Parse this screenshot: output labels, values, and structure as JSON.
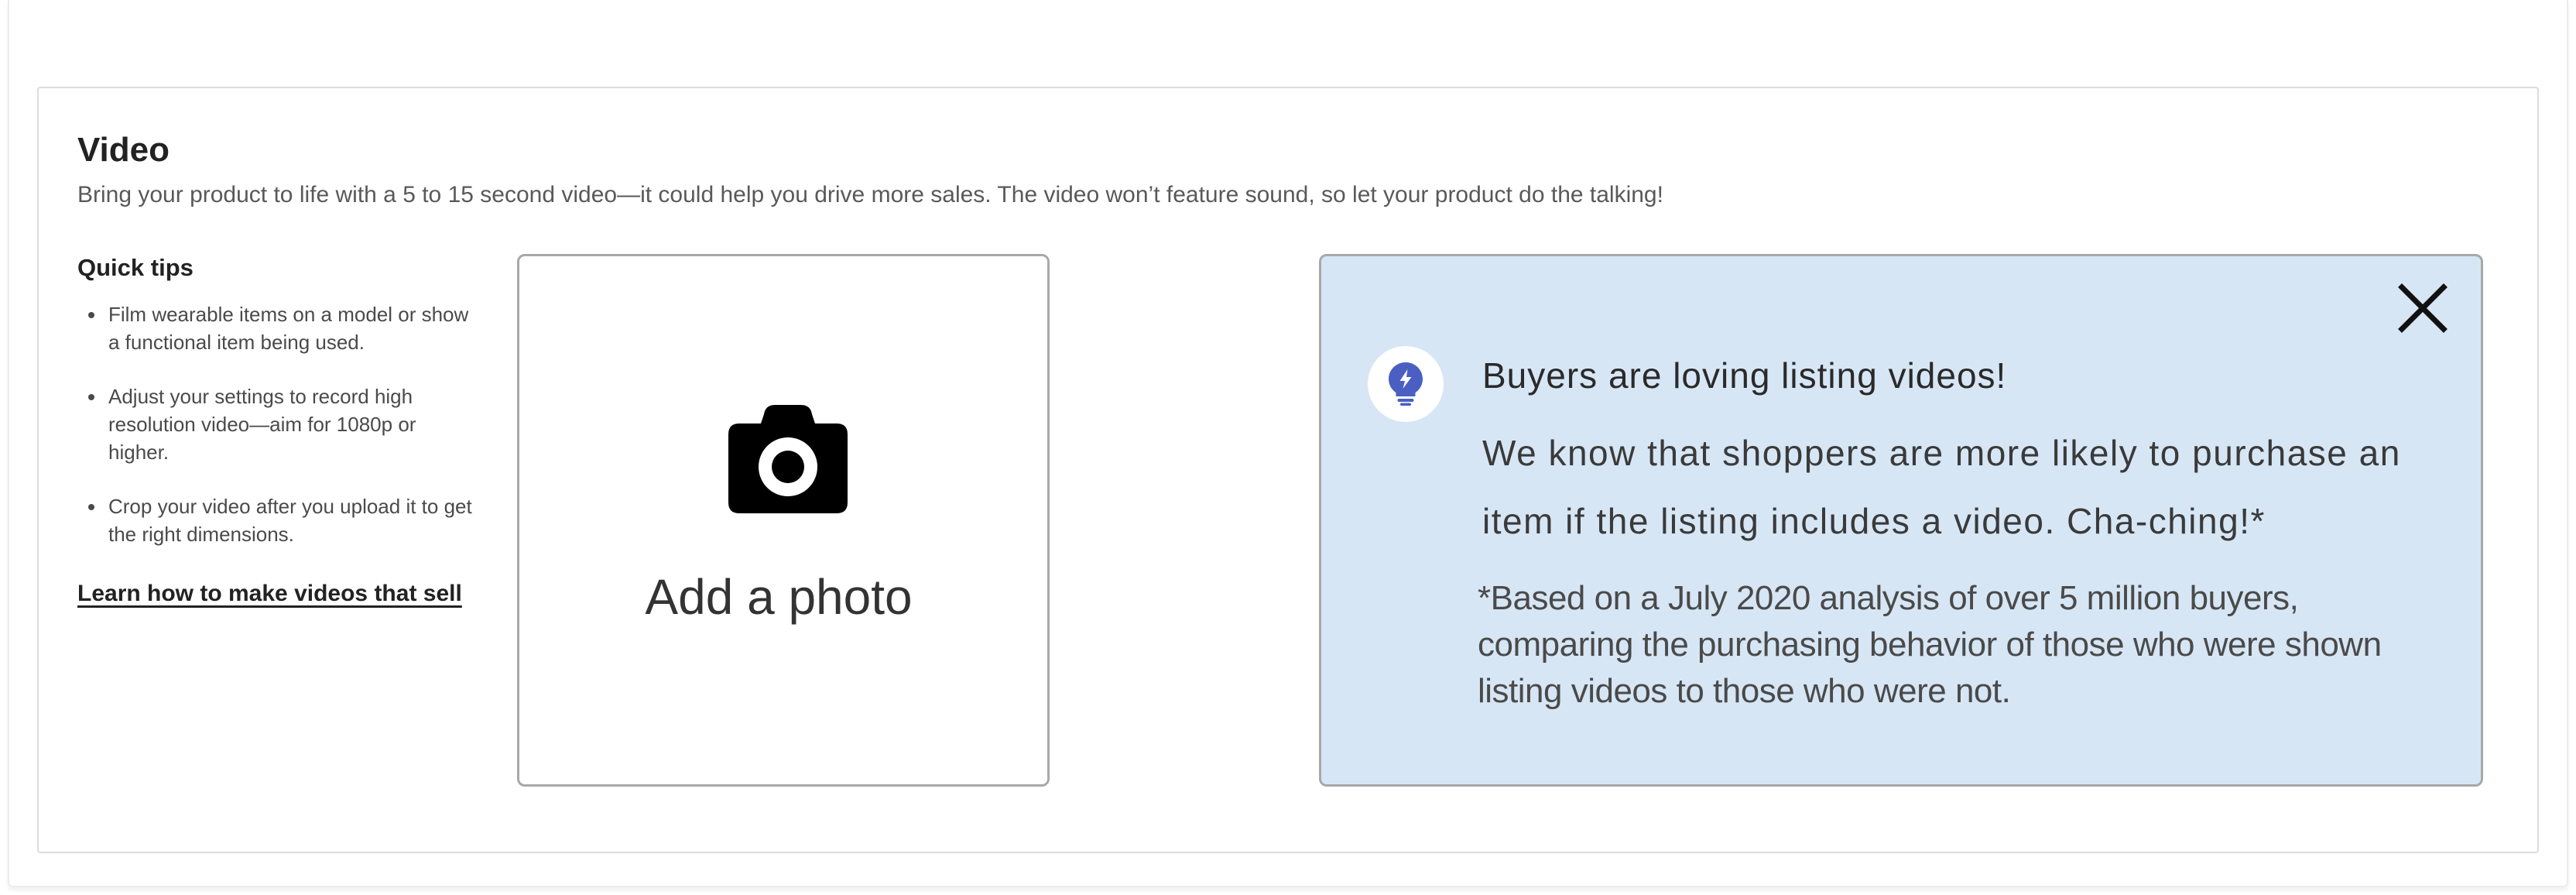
{
  "section": {
    "title": "Video",
    "description": "Bring your product to life with a 5 to 15 second video—it could help you drive more sales. The video won’t feature sound, so let your product do the talking!"
  },
  "tips": {
    "heading": "Quick tips",
    "items": [
      "Film wearable items on a model or show a functional item being used.",
      "Adjust your settings to record high resolution video—aim for 1080p or higher.",
      "Crop your video after you upload it to get the right dimensions."
    ],
    "link_label": "Learn how to make videos that sell"
  },
  "upload": {
    "label": "Add a photo",
    "icon": "camera-icon"
  },
  "info": {
    "headline": "Buyers are loving listing videos!",
    "body": "We know that shoppers are more likely to purchase an item if the listing includes a video. Cha-ching!*",
    "footnote": "*Based on a July 2020 analysis of over 5 million buyers, comparing the purchasing behavior of those who were shown listing videos to those who were not.",
    "icon": "lightbulb-icon",
    "close_icon": "close-icon"
  },
  "colors": {
    "info_background": "#d7e6f5",
    "bulb_accent": "#4a5fc1",
    "border": "#a8a8a8"
  }
}
